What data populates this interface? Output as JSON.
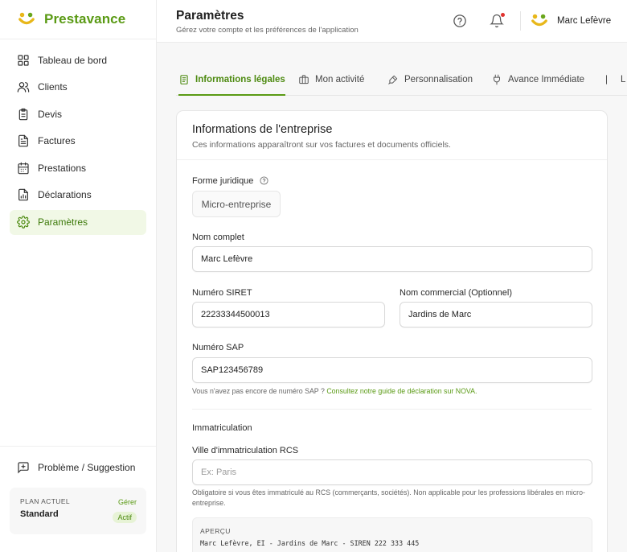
{
  "brand": {
    "name": "Prestavance",
    "logo_icon": "brand-logo-icon",
    "color": "#5a9a14"
  },
  "sidebar": {
    "items": [
      {
        "label": "Tableau de bord",
        "icon": "dashboard-icon",
        "active": false
      },
      {
        "label": "Clients",
        "icon": "users-icon",
        "active": false
      },
      {
        "label": "Devis",
        "icon": "clipboard-icon",
        "active": false
      },
      {
        "label": "Factures",
        "icon": "invoice-icon",
        "active": false
      },
      {
        "label": "Prestations",
        "icon": "calendar-icon",
        "active": false
      },
      {
        "label": "Déclarations",
        "icon": "file-chart-icon",
        "active": false
      },
      {
        "label": "Paramètres",
        "icon": "gear-icon",
        "active": true
      }
    ],
    "feedback_label": "Problème / Suggestion",
    "plan": {
      "label": "PLAN ACTUEL",
      "name": "Standard",
      "manage_label": "Gérer",
      "status": "Actif"
    }
  },
  "header": {
    "title": "Paramètres",
    "subtitle": "Gérez votre compte et les préférences de l'application",
    "user_name": "Marc Lefèvre"
  },
  "tabs": [
    {
      "label": "Informations légales",
      "icon": "document-icon",
      "active": true
    },
    {
      "label": "Mon activité",
      "icon": "briefcase-icon",
      "active": false
    },
    {
      "label": "Personnalisation",
      "icon": "brush-icon",
      "active": false
    },
    {
      "label": "Avance Immédiate",
      "icon": "plug-icon",
      "active": false
    },
    {
      "label": "L",
      "icon": "truncated-tab-icon",
      "active": false
    }
  ],
  "form": {
    "title": "Informations de l'entreprise",
    "subtitle": "Ces informations apparaîtront sur vos factures et documents officiels.",
    "legal_form": {
      "label": "Forme juridique",
      "value": "Micro-entreprise"
    },
    "full_name": {
      "label": "Nom complet",
      "value": "Marc Lefèvre"
    },
    "siret": {
      "label": "Numéro SIRET",
      "value": "22233344500013"
    },
    "trade_name": {
      "label": "Nom commercial (Optionnel)",
      "value": "Jardins de Marc"
    },
    "sap": {
      "label": "Numéro SAP",
      "value": "SAP123456789"
    },
    "sap_hint": "Vous n'avez pas encore de numéro SAP ? ",
    "sap_hint_link": "Consultez notre guide de déclaration sur NOVA.",
    "registration_section": "Immatriculation",
    "rcs_city": {
      "label": "Ville d'immatriculation RCS",
      "placeholder": "Ex: Paris",
      "value": ""
    },
    "rcs_hint": "Obligatoire si vous êtes immatriculé au RCS (commerçants, sociétés). Non applicable pour les professions libérales en micro-entreprise.",
    "preview": {
      "label": "APERÇU",
      "text": "Marc Lefèvre, EI - Jardins de Marc - SIREN 222 333 445"
    }
  },
  "colors": {
    "accent": "#5a9a14",
    "active_bg": "#f1f8e6",
    "notification": "#e0332f"
  }
}
